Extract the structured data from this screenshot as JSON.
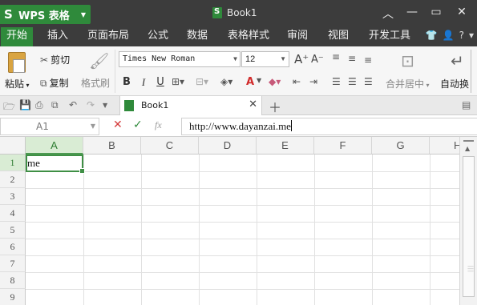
{
  "app": {
    "name": "WPS 表格",
    "logo_letter": "S",
    "document_title": "Book1",
    "accent": "#2f8a3b"
  },
  "window_controls": [
    "chevron-up-icon",
    "minimize-icon",
    "maximize-icon",
    "close-icon"
  ],
  "menu": {
    "tabs": [
      "开始",
      "插入",
      "页面布局",
      "公式",
      "数据",
      "表格样式",
      "审阅",
      "视图",
      "开发工具"
    ],
    "active_tab": "开始"
  },
  "ribbon": {
    "paste_label": "粘贴",
    "cut_label": "剪切",
    "copy_label": "复制",
    "format_painter_label": "格式刷",
    "font_name": "Times New Roman",
    "font_size": "12",
    "grow_font": "A⁺",
    "shrink_font": "A⁻",
    "bold": "B",
    "italic": "I",
    "underline": "U",
    "font_color_letter": "A",
    "merge_center_label": "合并居中",
    "wrap_text_label": "自动换"
  },
  "tabs_bar": {
    "file_tab": "Book1"
  },
  "formula_bar": {
    "cell_ref": "A1",
    "fx": "fx",
    "content": "http://www.dayanzai.me"
  },
  "sheet": {
    "columns": [
      "A",
      "B",
      "C",
      "D",
      "E",
      "F",
      "G",
      "H"
    ],
    "rows": [
      "1",
      "2",
      "3",
      "4",
      "5",
      "6",
      "7",
      "8",
      "9"
    ],
    "selected_column": "A",
    "selected_row": "1",
    "cells": {
      "A1": "me"
    }
  }
}
